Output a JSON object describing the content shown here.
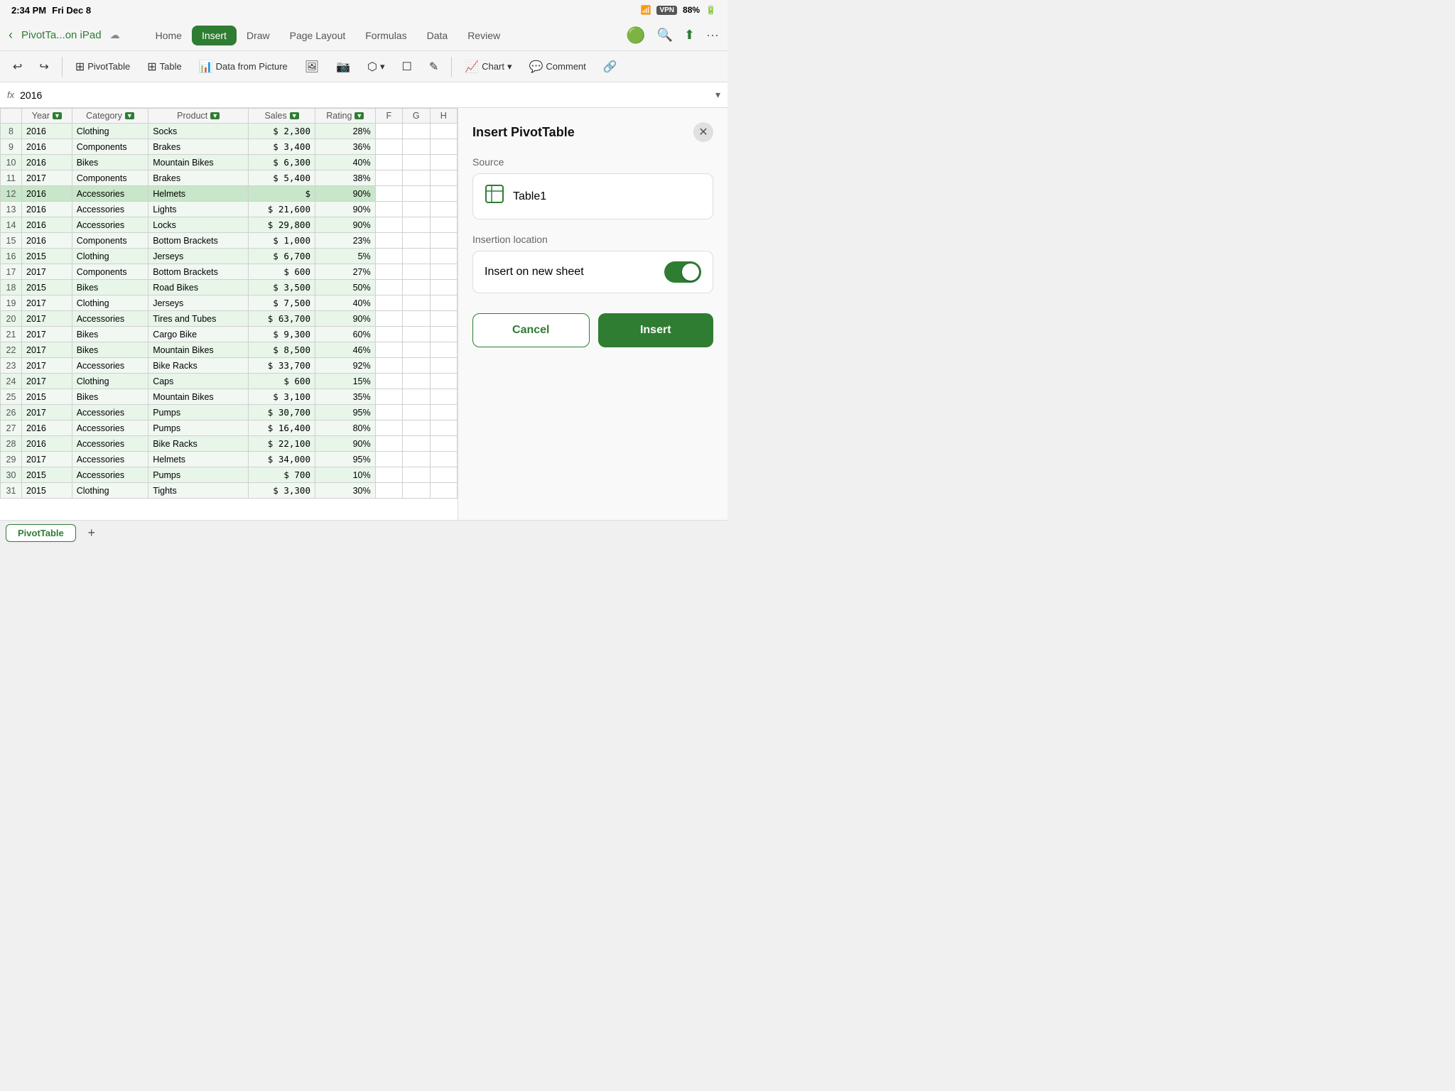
{
  "statusBar": {
    "time": "2:34 PM",
    "day": "Fri Dec 8",
    "vpn": "VPN",
    "battery": "88%"
  },
  "navBar": {
    "backIcon": "‹",
    "title": "PivotTa...on iPad",
    "cloudIcon": "☁",
    "tabs": [
      "Home",
      "Insert",
      "Draw",
      "Page Layout",
      "Formulas",
      "Data",
      "Review"
    ],
    "activeTab": "Insert",
    "searchIcon": "🔍",
    "shareIcon": "⬆",
    "moreIcon": "···"
  },
  "toolbar": {
    "undoIcon": "↩",
    "redoIcon": "↪",
    "pivotTableLabel": "PivotTable",
    "tableLabel": "Table",
    "dataFromPictureLabel": "Data from Picture",
    "imagesIcon": "🖼",
    "cameraIcon": "📷",
    "shapesLabel": "Shapes",
    "textboxLabel": "☐",
    "drawIcon": "✎",
    "chartLabel": "Chart",
    "commentLabel": "Comment",
    "linkIcon": "🔗"
  },
  "formulaBar": {
    "fx": "fx",
    "cellRef": "2016",
    "arrow": "▾"
  },
  "columns": {
    "rowHeader": "",
    "headers": [
      "Year",
      "Category",
      "Product",
      "Sales",
      "Rating",
      "F",
      "G",
      "H"
    ]
  },
  "rows": [
    {
      "num": "8",
      "year": "2016",
      "category": "Clothing",
      "product": "Socks",
      "sales": "$ 2,300",
      "rating": "28%",
      "selected": false
    },
    {
      "num": "9",
      "year": "2016",
      "category": "Components",
      "product": "Brakes",
      "sales": "$ 3,400",
      "rating": "36%",
      "selected": false
    },
    {
      "num": "10",
      "year": "2016",
      "category": "Bikes",
      "product": "Mountain Bikes",
      "sales": "$ 6,300",
      "rating": "40%",
      "selected": false
    },
    {
      "num": "11",
      "year": "2017",
      "category": "Components",
      "product": "Brakes",
      "sales": "$ 5,400",
      "rating": "38%",
      "selected": false
    },
    {
      "num": "12",
      "year": "2016",
      "category": "Accessories",
      "product": "Helmets",
      "sales": "$",
      "rating": "90%",
      "selected": true
    },
    {
      "num": "13",
      "year": "2016",
      "category": "Accessories",
      "product": "Lights",
      "sales": "$ 21,600",
      "rating": "90%",
      "selected": false
    },
    {
      "num": "14",
      "year": "2016",
      "category": "Accessories",
      "product": "Locks",
      "sales": "$ 29,800",
      "rating": "90%",
      "selected": false
    },
    {
      "num": "15",
      "year": "2016",
      "category": "Components",
      "product": "Bottom Brackets",
      "sales": "$ 1,000",
      "rating": "23%",
      "selected": false
    },
    {
      "num": "16",
      "year": "2015",
      "category": "Clothing",
      "product": "Jerseys",
      "sales": "$ 6,700",
      "rating": "5%",
      "selected": false
    },
    {
      "num": "17",
      "year": "2017",
      "category": "Components",
      "product": "Bottom Brackets",
      "sales": "$   600",
      "rating": "27%",
      "selected": false
    },
    {
      "num": "18",
      "year": "2015",
      "category": "Bikes",
      "product": "Road Bikes",
      "sales": "$ 3,500",
      "rating": "50%",
      "selected": false
    },
    {
      "num": "19",
      "year": "2017",
      "category": "Clothing",
      "product": "Jerseys",
      "sales": "$ 7,500",
      "rating": "40%",
      "selected": false
    },
    {
      "num": "20",
      "year": "2017",
      "category": "Accessories",
      "product": "Tires and Tubes",
      "sales": "$ 63,700",
      "rating": "90%",
      "selected": false
    },
    {
      "num": "21",
      "year": "2017",
      "category": "Bikes",
      "product": "Cargo Bike",
      "sales": "$ 9,300",
      "rating": "60%",
      "selected": false
    },
    {
      "num": "22",
      "year": "2017",
      "category": "Bikes",
      "product": "Mountain Bikes",
      "sales": "$ 8,500",
      "rating": "46%",
      "selected": false
    },
    {
      "num": "23",
      "year": "2017",
      "category": "Accessories",
      "product": "Bike Racks",
      "sales": "$ 33,700",
      "rating": "92%",
      "selected": false
    },
    {
      "num": "24",
      "year": "2017",
      "category": "Clothing",
      "product": "Caps",
      "sales": "$   600",
      "rating": "15%",
      "selected": false
    },
    {
      "num": "25",
      "year": "2015",
      "category": "Bikes",
      "product": "Mountain Bikes",
      "sales": "$ 3,100",
      "rating": "35%",
      "selected": false
    },
    {
      "num": "26",
      "year": "2017",
      "category": "Accessories",
      "product": "Pumps",
      "sales": "$ 30,700",
      "rating": "95%",
      "selected": false
    },
    {
      "num": "27",
      "year": "2016",
      "category": "Accessories",
      "product": "Pumps",
      "sales": "$ 16,400",
      "rating": "80%",
      "selected": false
    },
    {
      "num": "28",
      "year": "2016",
      "category": "Accessories",
      "product": "Bike Racks",
      "sales": "$ 22,100",
      "rating": "90%",
      "selected": false
    },
    {
      "num": "29",
      "year": "2017",
      "category": "Accessories",
      "product": "Helmets",
      "sales": "$ 34,000",
      "rating": "95%",
      "selected": false
    },
    {
      "num": "30",
      "year": "2015",
      "category": "Accessories",
      "product": "Pumps",
      "sales": "$   700",
      "rating": "10%",
      "selected": false
    },
    {
      "num": "31",
      "year": "2015",
      "category": "Clothing",
      "product": "Tights",
      "sales": "$ 3,300",
      "rating": "30%",
      "selected": false
    }
  ],
  "sidePanel": {
    "title": "Insert PivotTable",
    "closeIcon": "✕",
    "sourceLabel": "Source",
    "sourceIcon": "⊞",
    "sourceName": "Table1",
    "insertionLabel": "Insertion location",
    "insertOnNewSheetLabel": "Insert on new sheet",
    "toggleOn": true,
    "cancelLabel": "Cancel",
    "insertLabel": "Insert"
  },
  "sheetTabs": {
    "tabs": [
      "PivotTable"
    ],
    "activeTab": "PivotTable",
    "addIcon": "+"
  }
}
